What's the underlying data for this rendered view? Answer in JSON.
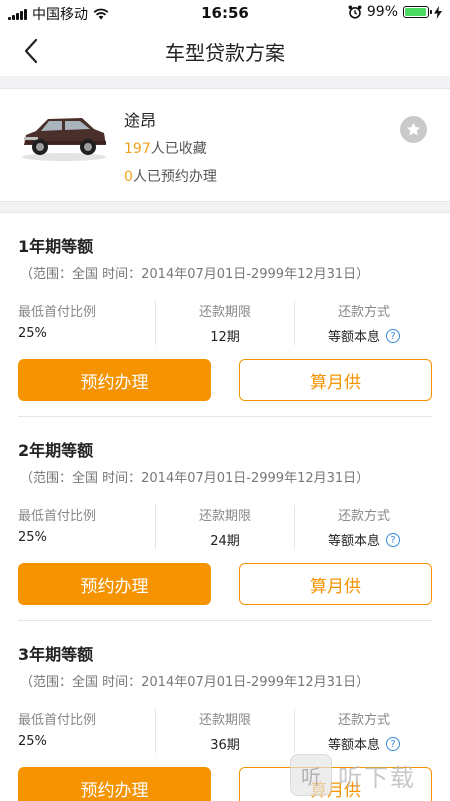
{
  "status_bar": {
    "carrier": "中国移动",
    "time": "16:56",
    "battery": "99%"
  },
  "nav": {
    "title": "车型贷款方案"
  },
  "car": {
    "name": "途昂",
    "favorites_count": "197",
    "favorites_text": "人已收藏",
    "reserve_count": "0",
    "reserve_text": "人已预约办理"
  },
  "plans": [
    {
      "title": "1年期等额",
      "range": "（范围：全国  时间：2014年07月01日-2999年12月31日）",
      "down_payment_label": "最低首付比例",
      "down_payment_value": "25%",
      "term_label": "还款期限",
      "term_value": "12期",
      "method_label": "还款方式",
      "method_value": "等额本息",
      "reserve_button": "预约办理",
      "calc_button": "算月供"
    },
    {
      "title": "2年期等额",
      "range": "（范围：全国  时间：2014年07月01日-2999年12月31日）",
      "down_payment_label": "最低首付比例",
      "down_payment_value": "25%",
      "term_label": "还款期限",
      "term_value": "24期",
      "method_label": "还款方式",
      "method_value": "等额本息",
      "reserve_button": "预约办理",
      "calc_button": "算月供"
    },
    {
      "title": "3年期等额",
      "range": "（范围：全国  时间：2014年07月01日-2999年12月31日）",
      "down_payment_label": "最低首付比例",
      "down_payment_value": "25%",
      "term_label": "还款期限",
      "term_value": "36期",
      "method_label": "还款方式",
      "method_value": "等额本息",
      "reserve_button": "预约办理",
      "calc_button": "算月供"
    }
  ],
  "watermark": {
    "text": "听下载"
  },
  "colors": {
    "accent": "#f59300",
    "highlight_number": "#f0a11a",
    "help": "#3b8ed8"
  }
}
